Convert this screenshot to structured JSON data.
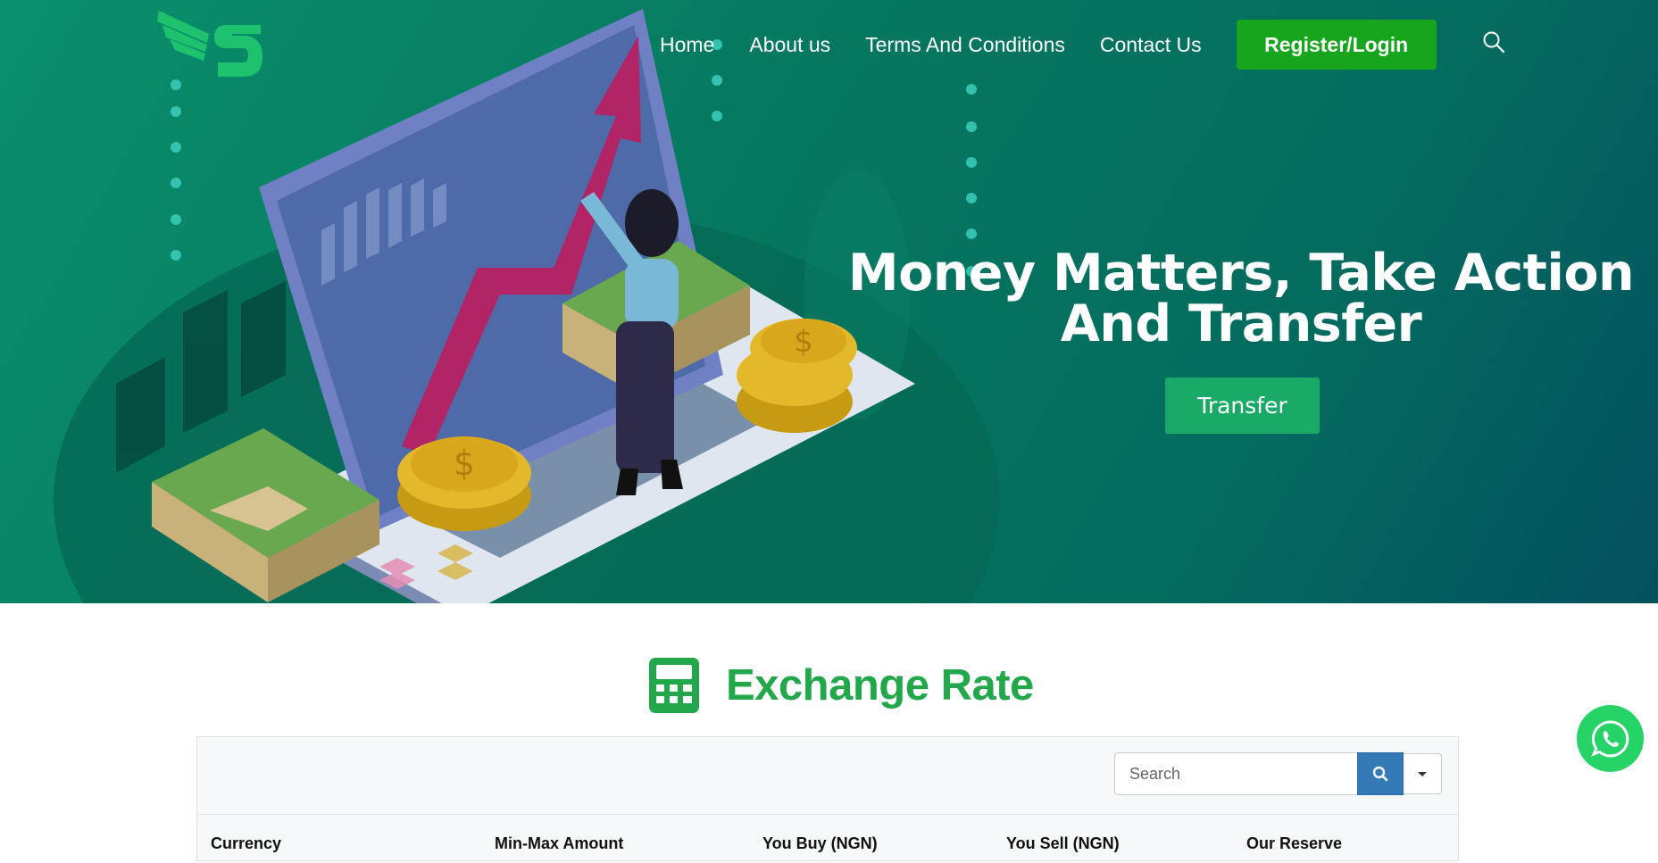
{
  "brand": {
    "logo_icon": "wing-dollar-logo-icon",
    "accent": "#17a51d"
  },
  "nav": {
    "items": [
      {
        "label": "Home"
      },
      {
        "label": "About us"
      },
      {
        "label": "Terms And Conditions"
      },
      {
        "label": "Contact Us"
      }
    ],
    "register_label": "Register/Login",
    "search_icon": "search-icon"
  },
  "hero": {
    "title": "Money Matters, Take Action And Transfer",
    "cta_label": "Transfer",
    "illustration": "laptop-growth-chart-illustration"
  },
  "exchange": {
    "icon": "calculator-icon",
    "title": "Exchange Rate",
    "search_placeholder": "Search",
    "columns": [
      "Currency",
      "Min-Max Amount",
      "You Buy (NGN)",
      "You Sell (NGN)",
      "Our Reserve"
    ]
  },
  "whatsapp": {
    "icon": "whatsapp-icon"
  },
  "colors": {
    "hero_start": "#0a8f6c",
    "hero_end": "#03505f",
    "title_green": "#22a84b",
    "transfer_btn": "#1aaa67",
    "search_btn": "#337ab7",
    "whatsapp": "#25d366"
  }
}
